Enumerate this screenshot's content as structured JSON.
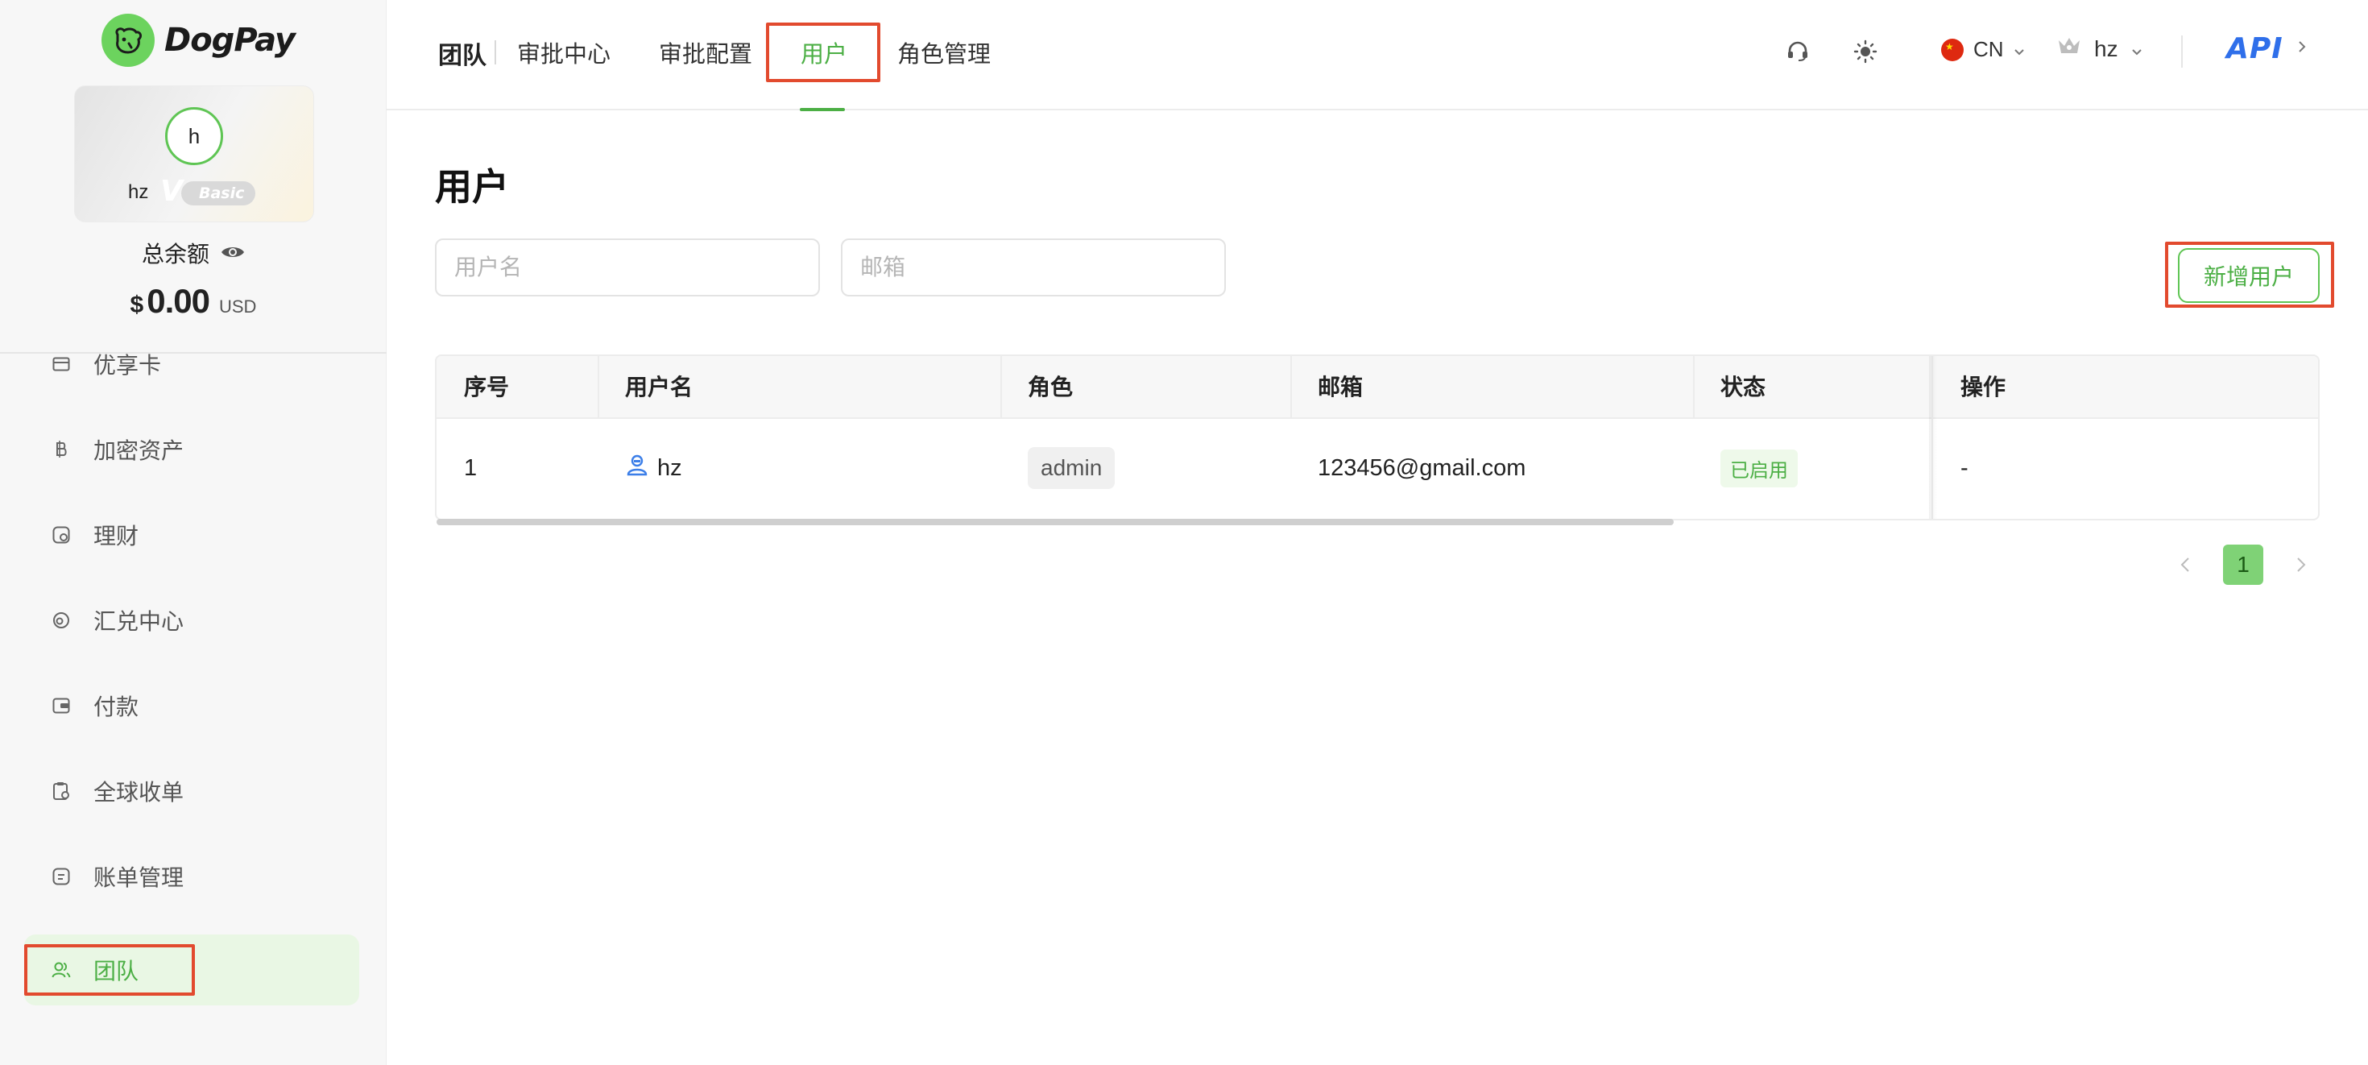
{
  "brand": {
    "name": "DogPay",
    "color": "#6cd35e"
  },
  "profile": {
    "avatar_initial": "h",
    "username": "hz",
    "level_mark": "V",
    "level": "Basic"
  },
  "balance": {
    "label": "总余额",
    "currency_symbol": "$",
    "amount": "0.00",
    "unit": "USD"
  },
  "sidebar": {
    "items": [
      {
        "label": "优享卡",
        "icon": "card-icon"
      },
      {
        "label": "加密资产",
        "icon": "bitcoin-icon"
      },
      {
        "label": "理财",
        "icon": "wealth-icon"
      },
      {
        "label": "汇兑中心",
        "icon": "exchange-icon"
      },
      {
        "label": "付款",
        "icon": "wallet-icon"
      },
      {
        "label": "全球收单",
        "icon": "clipboard-icon"
      },
      {
        "label": "账单管理",
        "icon": "bill-icon"
      },
      {
        "label": "团队",
        "icon": "team-icon",
        "active": true
      }
    ]
  },
  "header": {
    "title": "团队",
    "tabs": [
      {
        "label": "审批中心"
      },
      {
        "label": "审批配置"
      },
      {
        "label": "用户",
        "active": true
      },
      {
        "label": "角色管理"
      }
    ],
    "lang": "CN",
    "user": "hz",
    "api": "API"
  },
  "main": {
    "title": "用户",
    "filters": {
      "username_placeholder": "用户名",
      "email_placeholder": "邮箱"
    },
    "add_button": "新增用户",
    "table": {
      "columns": [
        "序号",
        "用户名",
        "角色",
        "邮箱",
        "状态",
        "操作"
      ],
      "rows": [
        {
          "index": "1",
          "username": "hz",
          "role": "admin",
          "email": "123456@gmail.com",
          "status": "已启用",
          "action": "-"
        }
      ]
    },
    "pagination": {
      "current": "1"
    }
  },
  "colors": {
    "accent": "#4caf45",
    "highlight": "#e24a2e",
    "api": "#2f6fea"
  }
}
